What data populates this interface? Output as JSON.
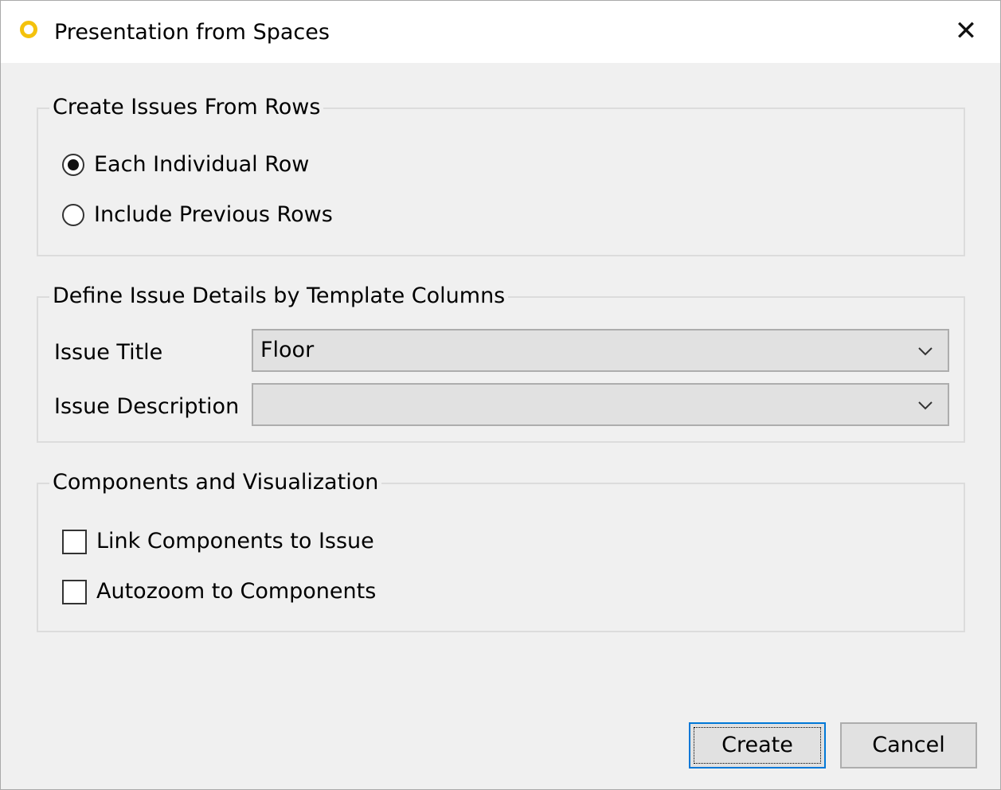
{
  "window": {
    "title": "Presentation from Spaces",
    "close_glyph": "✕",
    "icon": "app-ring-icon",
    "icon_color": "#f4c20d"
  },
  "group_rows": {
    "title": "Create Issues From Rows",
    "options": [
      {
        "label": "Each Individual Row",
        "selected": true
      },
      {
        "label": "Include Previous Rows",
        "selected": false
      }
    ]
  },
  "group_details": {
    "title": "Define Issue Details by Template Columns",
    "issue_title": {
      "label": "Issue Title",
      "value": "Floor"
    },
    "issue_description": {
      "label": "Issue Description",
      "value": ""
    }
  },
  "group_components": {
    "title": "Components and Visualization",
    "options": [
      {
        "label": "Link Components to Issue",
        "checked": false
      },
      {
        "label": "Autozoom to Components",
        "checked": false
      }
    ]
  },
  "buttons": {
    "create": "Create",
    "cancel": "Cancel",
    "default_border_color": "#0078d7"
  }
}
